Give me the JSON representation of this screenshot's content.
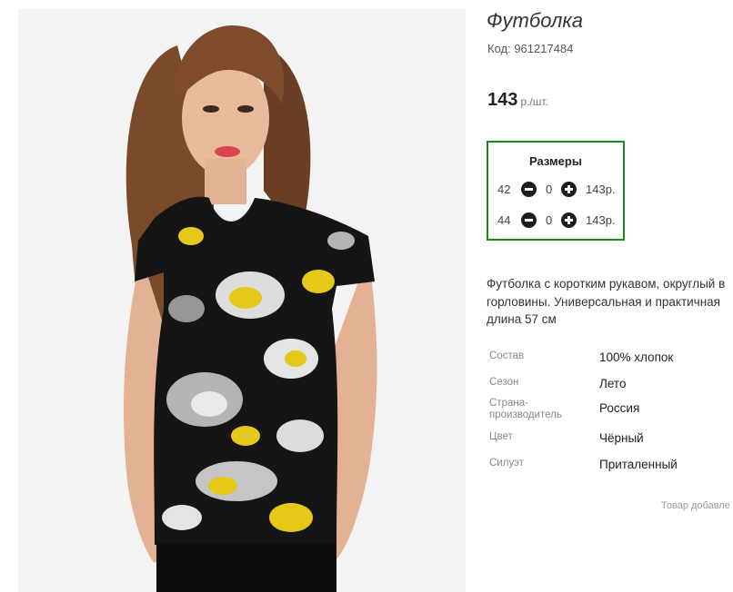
{
  "product": {
    "title": "Футболка",
    "code": "Код: 961217484",
    "price": "143",
    "price_unit": "р./шт."
  },
  "sizes": {
    "title": "Размеры",
    "rows": [
      {
        "size": "42",
        "qty": "0",
        "price": "143р."
      },
      {
        "size": "44",
        "qty": "0",
        "price": "143р."
      }
    ]
  },
  "description": {
    "line1": "Футболка с коротким рукавом, округлый в",
    "line2": "горловины. Универсальная и практичная",
    "line3": "длина 57 см"
  },
  "attributes": [
    {
      "key": "Состав",
      "value": "100% хлопок"
    },
    {
      "key": "Сезон",
      "value": "Лето"
    },
    {
      "key_line1": "Страна-",
      "key_line2": "производитель",
      "value": "Россия"
    },
    {
      "key": "Цвет",
      "value": "Чёрный"
    },
    {
      "key": "Силуэт",
      "value": "Приталенный"
    }
  ],
  "footer_note": "Товар добавле",
  "colors": {
    "accent_border": "#1a8a1a",
    "button": "#1e1e1e"
  }
}
